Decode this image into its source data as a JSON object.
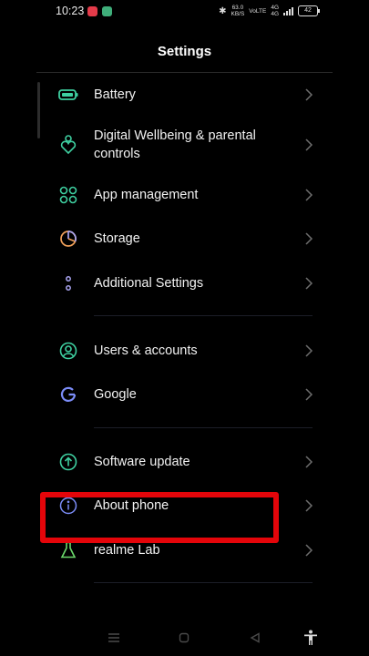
{
  "status_bar": {
    "time": "10:23",
    "net_speed": "63.0\nKB/S",
    "volte": "VoLTE",
    "network": "4G\n4G",
    "battery": "42"
  },
  "header": {
    "title": "Settings"
  },
  "items": [
    {
      "label": "Battery",
      "icon": "battery-icon",
      "color": "#3ecfa0"
    },
    {
      "label": "Digital Wellbeing & parental controls",
      "icon": "heart-person-icon",
      "color": "#3ecfa0"
    },
    {
      "label": "App management",
      "icon": "app-grid-icon",
      "color": "#3ecfa0"
    },
    {
      "label": "Storage",
      "icon": "pie-chart-icon",
      "color": "#f0a05a"
    },
    {
      "label": "Additional Settings",
      "icon": "dots-icon",
      "color": "#a9a4f0"
    },
    {
      "label": "Users & accounts",
      "icon": "user-icon",
      "color": "#3ecfa0"
    },
    {
      "label": "Google",
      "icon": "google-icon",
      "color": "#7b8cf7"
    },
    {
      "label": "Software update",
      "icon": "upload-arrow-icon",
      "color": "#3ecfa0"
    },
    {
      "label": "About phone",
      "icon": "info-icon",
      "color": "#7b8cf7"
    },
    {
      "label": "realme Lab",
      "icon": "flask-icon",
      "color": "#6bd96b"
    }
  ],
  "annotation": {
    "color": "#e4050a",
    "target": "About phone"
  }
}
